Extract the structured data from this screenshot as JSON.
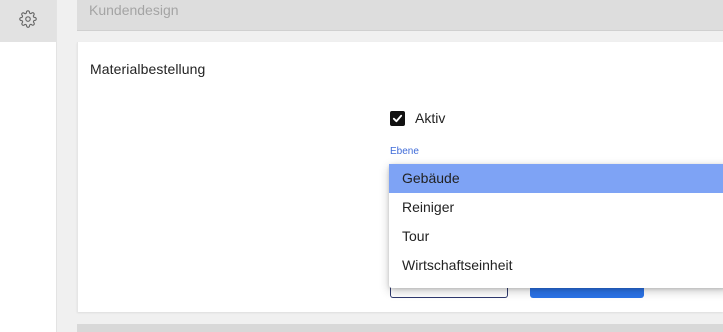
{
  "sidebar": {
    "items": [
      {
        "icon": "settings-gear-icon"
      }
    ]
  },
  "sections": {
    "top_panel_label": "Kundendesign",
    "card_title": "Materialbestellung"
  },
  "form": {
    "active": {
      "label": "Aktiv",
      "checked": true
    },
    "level_field": {
      "label": "Ebene",
      "selected": "Gebäude",
      "options": [
        "Gebäude",
        "Reiniger",
        "Tour",
        "Wirtschaftseinheit"
      ]
    }
  },
  "colors": {
    "accent": "#2a73e8",
    "selected_option_bg": "#7ea3f5",
    "field_label": "#3f6bd8"
  }
}
